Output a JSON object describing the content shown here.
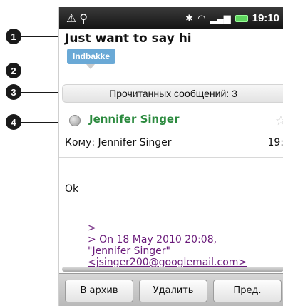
{
  "status_bar": {
    "left_icons": [
      "warning-icon",
      "usb-icon"
    ],
    "right_icons": [
      "bluetooth-icon",
      "wifi-icon",
      "signal-icon",
      "battery-icon"
    ],
    "time": "19:10"
  },
  "callouts": [
    "1",
    "2",
    "3",
    "4"
  ],
  "message": {
    "subject": "Just want to say hi",
    "folder_tag": "Indbakke",
    "read_count_text": "Прочитанных сообщений: 3",
    "sender": "Jennifer Singer",
    "to_line": "Кому: Jennifer Singer",
    "time_short": "19:",
    "body": "Ok",
    "quoted_lines": [
      ">",
      "> On 18 May 2010 20:08,",
      "\"Jennifer Singer\"",
      "<jsinger200@googlemail.com>"
    ]
  },
  "bottom_buttons": {
    "archive": "В архив",
    "delete": "Удалить",
    "previous": "Пред."
  },
  "colors": {
    "sender_green": "#2b8a3e",
    "quote_purple": "#6a1b7a",
    "tag_blue": "#6aa9d6"
  }
}
